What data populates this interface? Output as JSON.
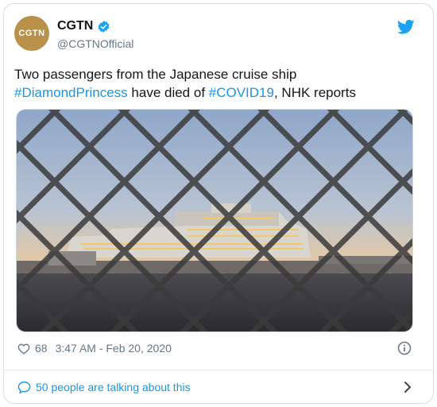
{
  "tweet": {
    "avatar_text": "CGTN",
    "author_name": "CGTN",
    "author_handle": "@CGTNOfficial",
    "text_line1": "Two passengers from the Japanese cruise ship",
    "hashtag1": "#DiamondPrincess",
    "text_mid": " have died of ",
    "hashtag2": "#COVID19",
    "text_end": ", NHK reports",
    "likes": "68",
    "timestamp": "3:47 AM - Feb 20, 2020",
    "talking": "50 people are talking about this"
  },
  "icons": {
    "verified": "verified-badge-icon",
    "logo": "twitter-bird-icon",
    "like": "heart-icon",
    "info": "info-icon",
    "comment": "speech-bubble-icon",
    "chevron": "chevron-right-icon"
  },
  "colors": {
    "accent": "#1b95e0",
    "avatar": "#b8924a",
    "muted": "#657786"
  }
}
